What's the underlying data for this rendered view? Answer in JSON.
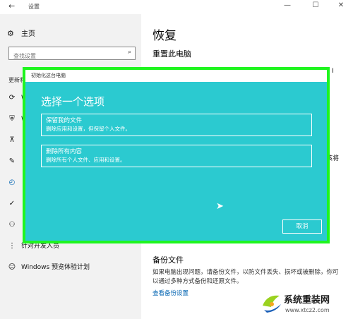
{
  "window": {
    "title": "设置",
    "back_glyph": "←",
    "minimize_glyph": "—",
    "maximize_glyph": "☐",
    "close_glyph": "✕"
  },
  "sidebar": {
    "home_label": "主页",
    "search": {
      "placeholder": "查找设置",
      "value": ""
    },
    "section_label": "更新和",
    "items": [
      {
        "icon": "refresh-icon",
        "glyph": "⟳",
        "label": "W"
      },
      {
        "icon": "shield-icon",
        "glyph": "⛨",
        "label": "W"
      },
      {
        "icon": "upload-icon",
        "glyph": "⊼",
        "label": ""
      },
      {
        "icon": "wrench-icon",
        "glyph": "✎",
        "label": ""
      },
      {
        "icon": "history-icon",
        "glyph": "◴",
        "label": ""
      },
      {
        "icon": "check-circle-icon",
        "glyph": "✓",
        "label": ""
      },
      {
        "icon": "person-icon",
        "glyph": "⚇",
        "label": ""
      },
      {
        "icon": "developer-icon",
        "glyph": "⋮",
        "label": "针对开发人员"
      },
      {
        "icon": "insider-icon",
        "glyph": "☺",
        "label": "Windows 预览体验计划"
      }
    ]
  },
  "main": {
    "title": "恢复",
    "reset_heading": "重置此电脑",
    "fragments": [
      "I",
      "t",
      "该将"
    ],
    "backup": {
      "heading": "备份文件",
      "description": "如果电脑出现问题，请备份文件，以防文件丢失、损坏或被删除，你可以通过多种方式备份和还原文件。",
      "link": "查看备份设置"
    }
  },
  "dialog": {
    "title": "初始化这台电脑",
    "heading": "选择一个选项",
    "options": [
      {
        "title": "保留我的文件",
        "description": "删除应用和设置，但保留个人文件。"
      },
      {
        "title": "删除所有内容",
        "description": "删除所有个人文件、应用和设置。"
      }
    ],
    "cancel_label": "取消"
  },
  "watermark": {
    "title": "系统重装网",
    "url": "www.xtcz2.com"
  },
  "colors": {
    "dialog_bg": "#2bcad0",
    "highlight_border": "#1ff51f",
    "accent": "#0063b1"
  }
}
